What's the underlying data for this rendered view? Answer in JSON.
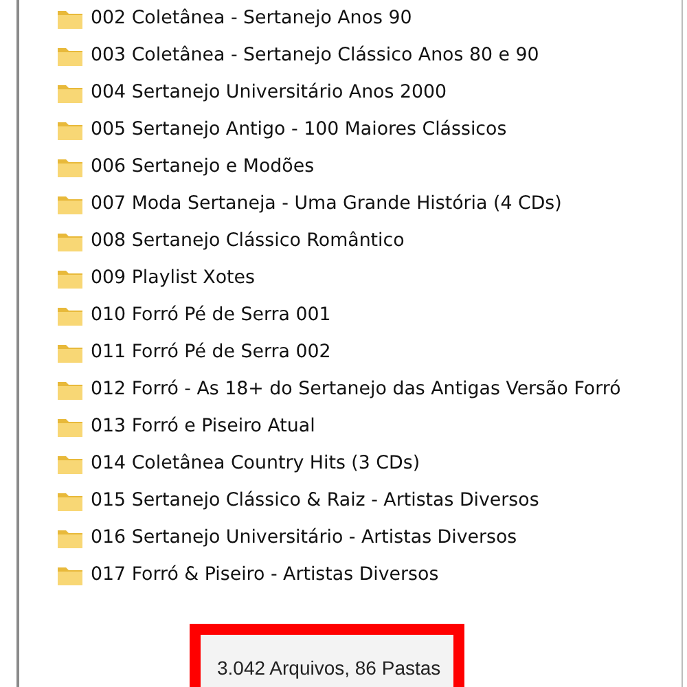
{
  "folders": [
    {
      "name": "002 Coletânea - Sertanejo Anos 90"
    },
    {
      "name": "003 Coletânea - Sertanejo Clássico Anos 80 e 90"
    },
    {
      "name": "004 Sertanejo Universitário Anos 2000"
    },
    {
      "name": "005 Sertanejo Antigo - 100 Maiores Clássicos"
    },
    {
      "name": "006 Sertanejo e Modões"
    },
    {
      "name": "007 Moda Sertaneja - Uma Grande História (4 CDs)"
    },
    {
      "name": "008 Sertanejo Clássico Romântico"
    },
    {
      "name": "009 Playlist Xotes"
    },
    {
      "name": "010 Forró Pé de Serra 001"
    },
    {
      "name": "011 Forró Pé de Serra 002"
    },
    {
      "name": "012 Forró - As 18+ do Sertanejo das Antigas Versão Forró"
    },
    {
      "name": "013 Forró e Piseiro Atual"
    },
    {
      "name": "014 Coletânea Country Hits (3 CDs)"
    },
    {
      "name": "015 Sertanejo Clássico & Raiz - Artistas Diversos"
    },
    {
      "name": "016 Sertanejo Universitário - Artistas Diversos"
    },
    {
      "name": "017 Forró & Piseiro - Artistas Diversos"
    }
  ],
  "summary": "3.042 Arquivos, 86 Pastas"
}
